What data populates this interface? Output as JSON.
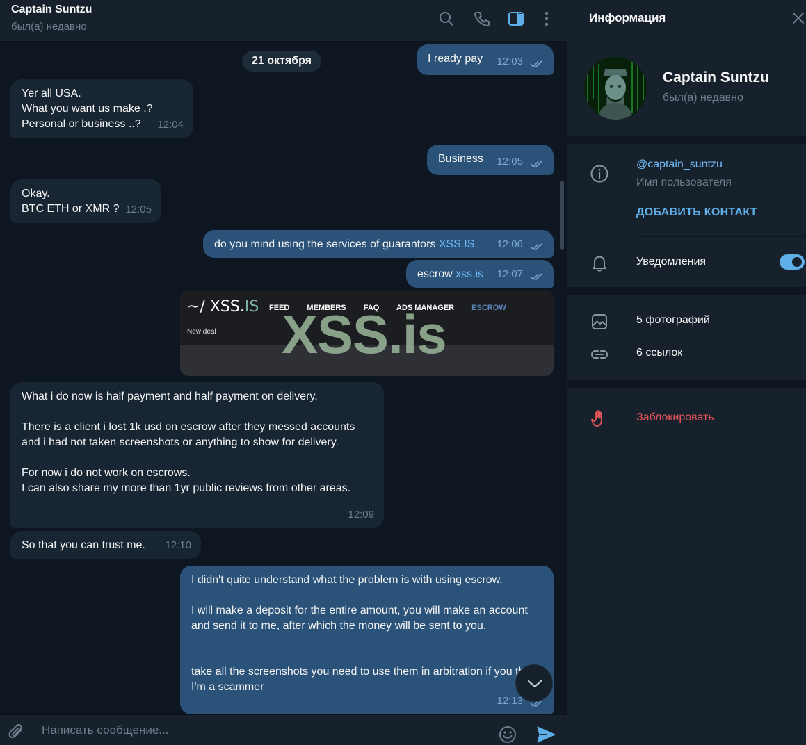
{
  "chat": {
    "title": "Captain Suntzu",
    "status": "был(а) недавно",
    "date_pill": "21 октября",
    "composer_placeholder": "Написать сообщение...",
    "messages": [
      {
        "dir": "out",
        "text": "I ready pay",
        "time": "12:03",
        "read": true
      },
      {
        "dir": "in",
        "text": "Yer all USA.\nWhat you want us make .?\nPersonal or business ..?",
        "time": "12:04"
      },
      {
        "dir": "out",
        "text": "Business",
        "time": "12:05",
        "read": true
      },
      {
        "dir": "in",
        "text": "Okay.\nBTC ETH or XMR ?",
        "time": "12:05"
      },
      {
        "dir": "out",
        "text_prefix": "do you mind using the services of guarantors ",
        "link": "XSS.IS",
        "time": "12:06",
        "read": true
      },
      {
        "dir": "out",
        "text_prefix": "escrow ",
        "link": "xss.is",
        "time": "12:07",
        "read": true
      },
      {
        "dir": "in",
        "text": "What i do now is half payment and half payment on delivery.\n\nThere is a client i lost 1k usd on escrow after they messed accounts and i had not taken screenshots or anything to show for delivery.\n\nFor now i do not work on escrows.\nI can also share my more than 1yr public reviews from other areas.",
        "time": "12:09"
      },
      {
        "dir": "in",
        "text": "So that you can trust me.",
        "time": "12:10"
      },
      {
        "dir": "out",
        "text": "I didn't quite understand what the problem is with using escrow.\n\nI will make a deposit for the entire amount, you will make an account and send it to me, after which the money will be sent to you.\n\n\ntake all the screenshots you need to use them in arbitration if you think I'm a scammer",
        "time": "12:13",
        "read": true
      }
    ],
    "link_preview": {
      "logo_prefix": "~/ XSS.",
      "logo_suffix": "IS",
      "nav": [
        "FEED",
        "MEMBERS",
        "FAQ",
        "ADS MANAGER",
        "ESCROW"
      ],
      "subtitle": "New deal",
      "watermark": "XSS.is"
    }
  },
  "info": {
    "title": "Информация",
    "name": "Captain Suntzu",
    "status": "был(а) недавно",
    "username": "@captain_suntzu",
    "username_caption": "Имя пользователя",
    "add_contact": "ДОБАВИТЬ КОНТАКТ",
    "notifications": "Уведомления",
    "notifications_on": true,
    "photos": "5 фотографий",
    "links": "6 ссылок",
    "block": "Заблокировать"
  },
  "colors": {
    "background": "#0e1621",
    "panel": "#17212b",
    "incoming": "#182533",
    "outgoing": "#2b5278",
    "accent": "#5eaee8",
    "danger": "#e6555a"
  },
  "icons": [
    "search-icon",
    "phone-icon",
    "sidebar-toggle-icon",
    "more-vert-icon",
    "close-icon",
    "info-icon",
    "bell-icon",
    "photo-icon",
    "link-icon",
    "hand-block-icon",
    "paperclip-icon",
    "emoji-icon",
    "send-icon",
    "chevron-down-icon",
    "double-check-icon"
  ]
}
